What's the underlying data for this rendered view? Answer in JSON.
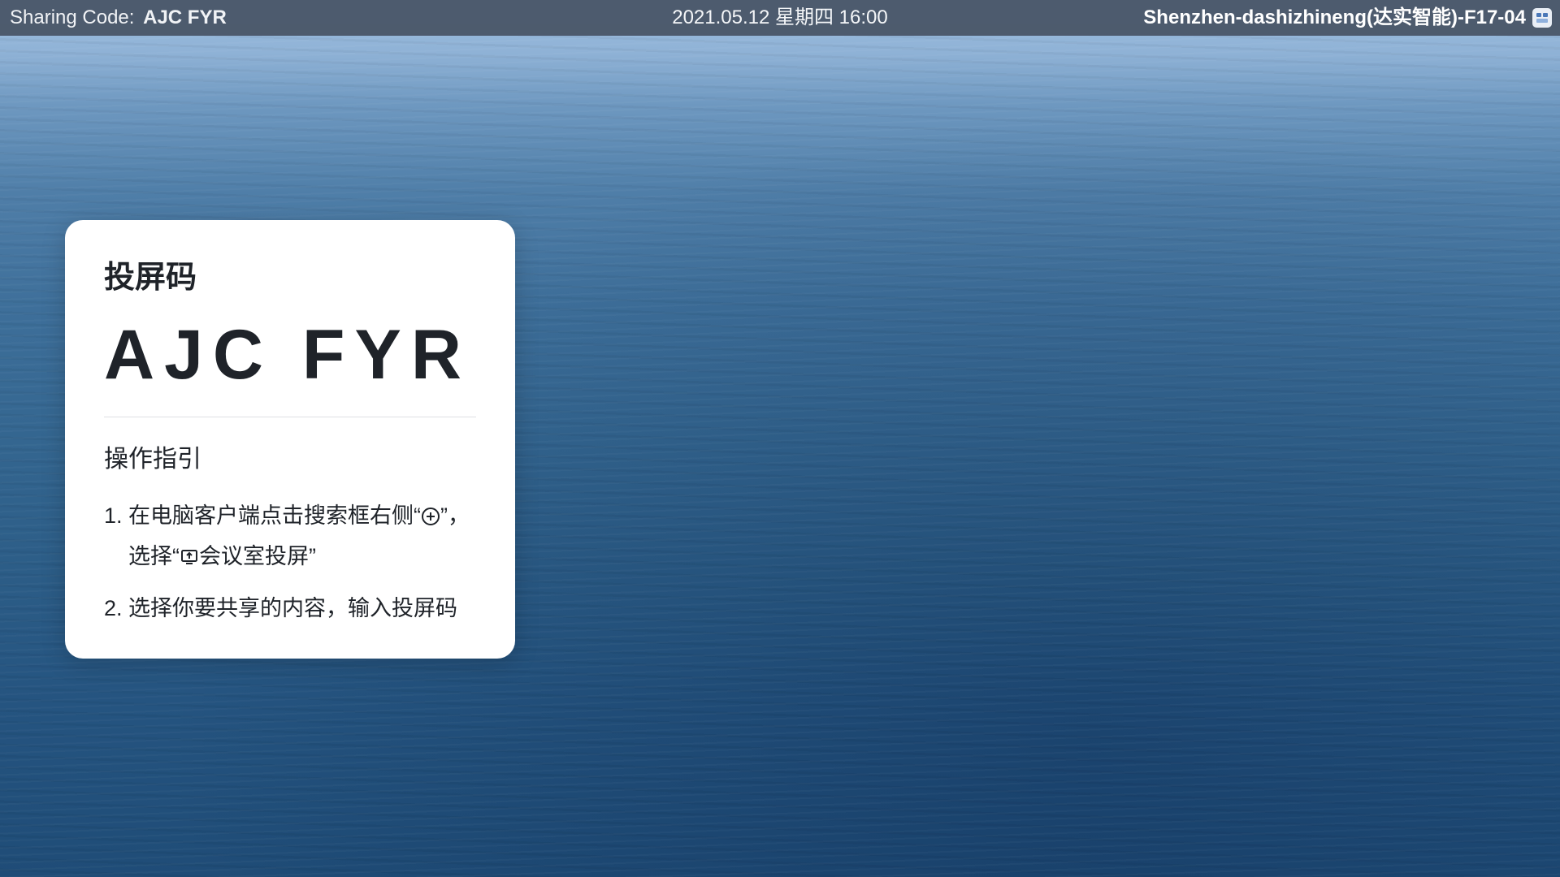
{
  "topbar": {
    "sharing_label": "Sharing Code:",
    "sharing_code": "AJC FYR",
    "datetime": "2021.05.12 星期四 16:00",
    "room_name": "Shenzhen-dashizhineng(达实智能)-F17-04",
    "room_icon": "meeting-room-icon"
  },
  "card": {
    "title": "投屏码",
    "code": "AJC FYR",
    "guide_title": "操作指引",
    "steps": [
      {
        "num": "1.",
        "part1": "在电脑客户端点击搜索框右侧“",
        "icon1": "plus-circle-icon",
        "part2": "”，",
        "part3": "选择“",
        "icon2": "screen-share-icon",
        "part4": "会议室投屏”"
      },
      {
        "num": "2.",
        "text": "选择你要共享的内容，输入投屏码"
      }
    ]
  },
  "colors": {
    "topbar_bg": "#465264",
    "card_bg": "#ffffff",
    "text_dark": "#1f2329",
    "ocean_top": "#9ebfe0",
    "ocean_bottom": "#1f4c77"
  }
}
